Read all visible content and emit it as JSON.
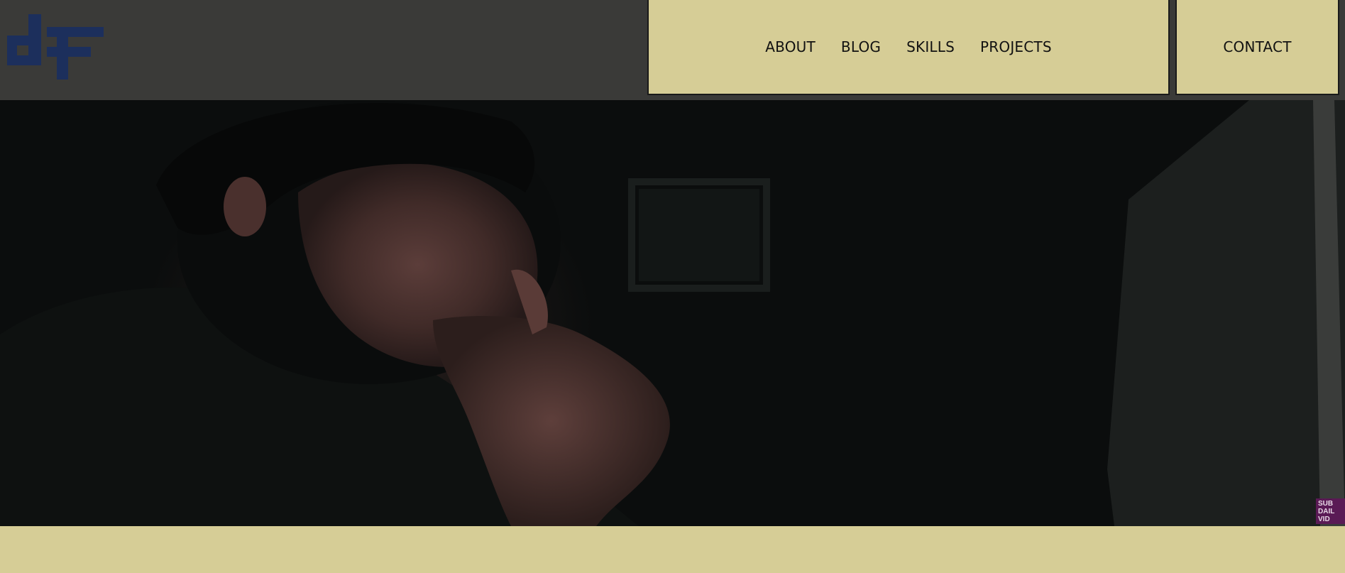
{
  "colors": {
    "header_bg": "#3a3a38",
    "accent": "#d6cd96",
    "logo_blue": "#1c2f5c",
    "text": "#111111"
  },
  "logo": {
    "icon": "df-logo-icon"
  },
  "nav": {
    "items": [
      {
        "label": "ABOUT"
      },
      {
        "label": "BLOG"
      },
      {
        "label": "SKILLS"
      },
      {
        "label": "PROJECTS"
      }
    ],
    "contact_label": "CONTACT"
  },
  "hero": {
    "badge_lines": [
      "SUB",
      "DAIL",
      "VID"
    ]
  }
}
